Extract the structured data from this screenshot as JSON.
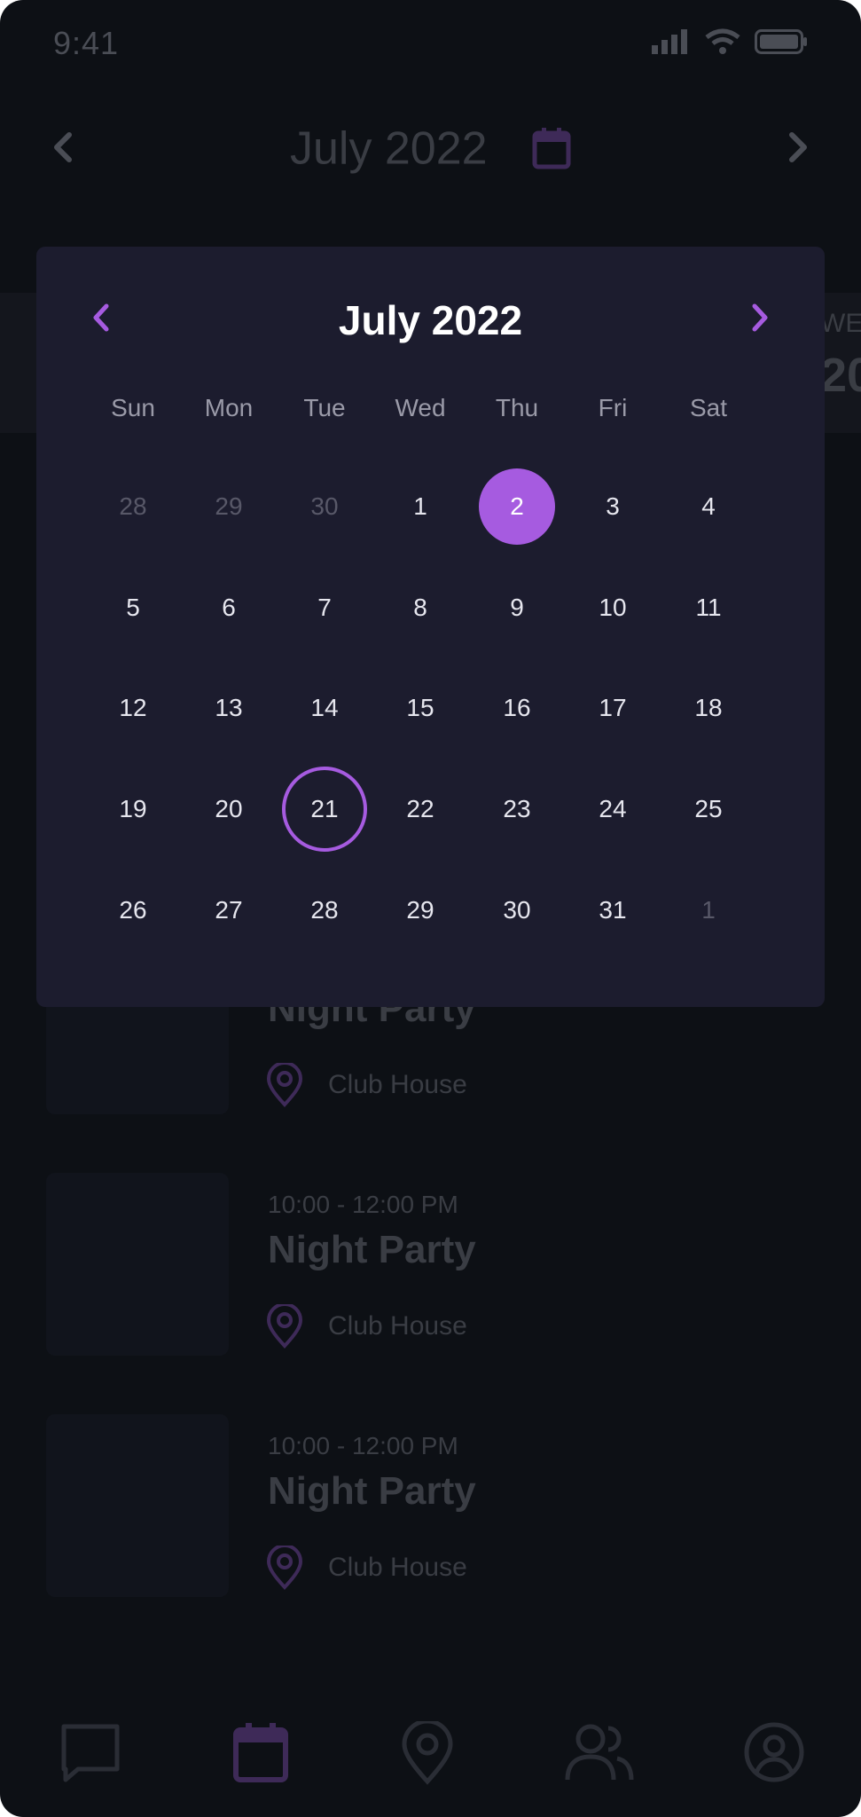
{
  "status_bar": {
    "time": "9:41"
  },
  "header": {
    "month_label": "July 2022"
  },
  "week_strip": {
    "day_label": "WE",
    "day_number": "20"
  },
  "events": [
    {
      "time": "",
      "title": "Night Party",
      "location": "Club House"
    },
    {
      "time": "10:00 - 12:00 PM",
      "title": "Night Party",
      "location": "Club House"
    },
    {
      "time": "10:00 - 12:00 PM",
      "title": "Night Party",
      "location": "Club House"
    }
  ],
  "calendar_popup": {
    "title": "July 2022",
    "weekdays": [
      "Sun",
      "Mon",
      "Tue",
      "Wed",
      "Thu",
      "Fri",
      "Sat"
    ],
    "weeks": [
      [
        "28",
        "29",
        "30",
        "1",
        "2",
        "3",
        "4"
      ],
      [
        "5",
        "6",
        "7",
        "8",
        "9",
        "10",
        "11"
      ],
      [
        "12",
        "13",
        "14",
        "15",
        "16",
        "17",
        "18"
      ],
      [
        "19",
        "20",
        "21",
        "22",
        "23",
        "24",
        "25"
      ],
      [
        "26",
        "27",
        "28",
        "29",
        "30",
        "31",
        "1"
      ]
    ],
    "selected_day": "2",
    "today_day": "21"
  },
  "bottom_nav": [
    "chat-icon",
    "calendar-icon",
    "location-pin-icon",
    "users-icon",
    "profile-icon"
  ],
  "colors": {
    "accent": "#a65be0",
    "popup_bg": "#1c1c2e",
    "screen_bg": "#0d1015"
  }
}
